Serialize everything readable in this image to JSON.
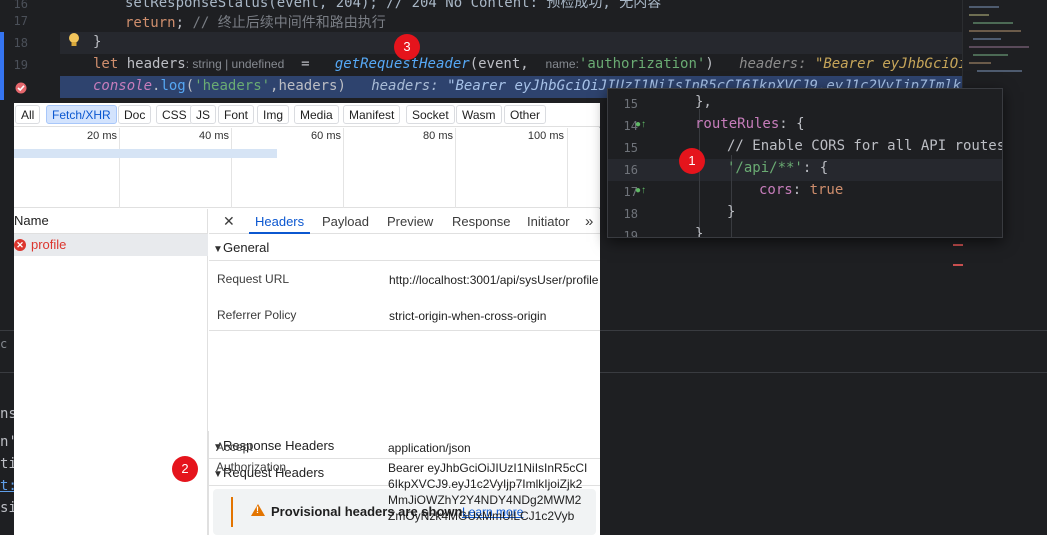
{
  "editor": {
    "lines": [
      {
        "num": "16",
        "text_a": "setResponseStatus(event, 204); // 204 No Content: 预检成功, 无内容"
      },
      {
        "num": "17",
        "kw": "return",
        "rest": ";",
        "comment": "// 终止后续中间件和路由执行"
      },
      {
        "num": "18",
        "text": "}"
      },
      {
        "num": "19",
        "kw": "let",
        "var": " headers",
        "type_hint": ": string | undefined",
        "assign": "  =   ",
        "fn": "getRequestHeader",
        "args_open": "(event,  ",
        "param_hint": "name:",
        "arg_str": "'authorization'",
        "args_close": ")",
        "inline_label": "headers: ",
        "inline_value": "\"Bearer eyJhbGciOiJ"
      },
      {
        "num": "20",
        "obj": "console",
        "dot": ".",
        "method": "log",
        "open": "(",
        "str": "'headers'",
        "comma": ",headers)",
        "inline_label": "headers: ",
        "inline_value": "\"Bearer eyJhbGciOiJIUzI1NiIsInR5cCI6IkpXVCJ9.eyJ1c2VyIjp7ImlkIjoiZj"
      }
    ],
    "side_texts": [
      "c",
      "ns",
      "n'",
      "ti",
      "t:",
      "si"
    ]
  },
  "devtools": {
    "filters": [
      "All",
      "Fetch/XHR",
      "Doc",
      "CSS",
      "JS",
      "Font",
      "Img",
      "Media",
      "Manifest",
      "Socket",
      "Wasm",
      "Other"
    ],
    "active_filter": "Fetch/XHR",
    "timeline_ticks": [
      "20 ms",
      "40 ms",
      "60 ms",
      "80 ms",
      "100 ms"
    ],
    "name_header": "Name",
    "request_name": "profile",
    "tabs": [
      "Headers",
      "Payload",
      "Preview",
      "Response",
      "Initiator"
    ],
    "active_tab": "Headers",
    "close_icon": "✕",
    "more_icon": "»",
    "general_title": "General",
    "request_url_label": "Request URL",
    "request_url_value": "http://localhost:3001/api/sysUser/profile",
    "referrer_label": "Referrer Policy",
    "referrer_value": "strict-origin-when-cross-origin",
    "response_headers_title": "Response Headers",
    "request_headers_title": "Request Headers",
    "provisional_text": "Provisional headers are shown.",
    "learn_more": "Learn more",
    "accept_label": "Accept",
    "accept_value": "application/json",
    "authorization_label": "Authorization",
    "authorization_value": "Bearer eyJhbGciOiJIUzI1NiIsInR5cCI6IkpXVCJ9.eyJ1c2VyIjp7ImlkIjoiZjk2MmJiOWZhY2Y4NDY4NDg2MWM2ZmOyNzk4MGUxMmUiLCJ1c2Vyb"
  },
  "config_popup": {
    "lines": [
      {
        "num": "15",
        "text": "},"
      },
      {
        "num": "14",
        "key": "routeRules",
        "rest": ": {"
      },
      {
        "num": "15",
        "comment": "// Enable CORS for all API routes"
      },
      {
        "num": "16",
        "str": "'/api/**'",
        "rest": ": {"
      },
      {
        "num": "17",
        "key": "cors",
        "rest": ": ",
        "kw": "true"
      },
      {
        "num": "18",
        "text": "}"
      },
      {
        "num": "19",
        "text": "}"
      }
    ]
  },
  "badges": {
    "one": "1",
    "two": "2",
    "three": "3"
  },
  "colors": {
    "accent": "#0b57d0",
    "badge": "#e5141c",
    "error": "#dc362e",
    "warning": "#e37400"
  }
}
